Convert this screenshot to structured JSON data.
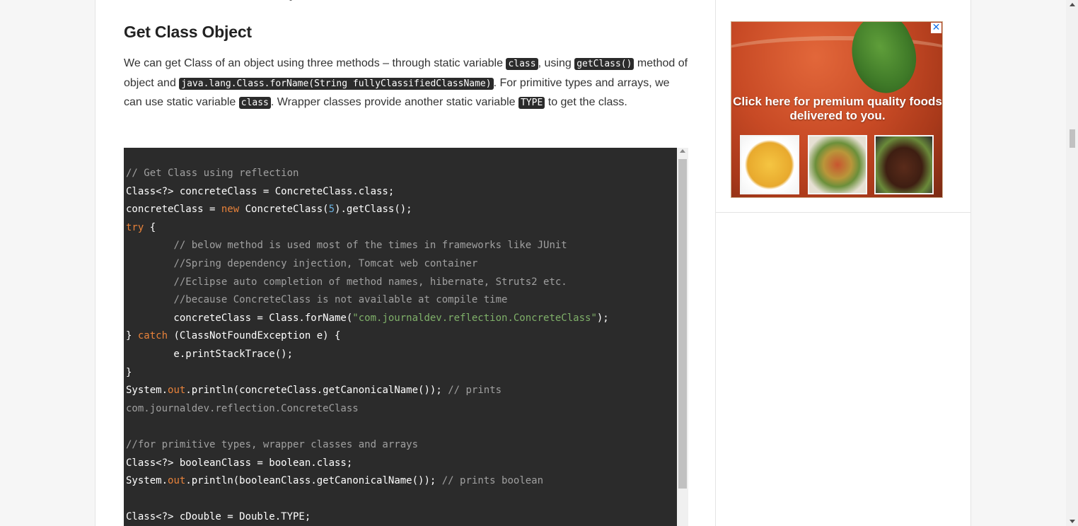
{
  "article": {
    "heading": "Get Class Object",
    "intro": {
      "p1": "We can get Class of an object using three methods – through static variable ",
      "code1": "class",
      "p2": ", using ",
      "code2": "getClass()",
      "p3": " method of object and ",
      "code3": "java.lang.Class.forName(String fullyClassifiedClassName)",
      "p4": ". For primitive types and arrays, we can use static variable ",
      "code4": "class",
      "p5": ". Wrapper classes provide another static variable ",
      "code5": "TYPE",
      "p6": " to get the class."
    },
    "code": [
      [
        {
          "t": "// Get Class using reflection",
          "c": "c-cm"
        }
      ],
      [
        {
          "t": "Class<?> concreteClass = ConcreteClass.class;"
        }
      ],
      [
        {
          "t": "concreteClass = "
        },
        {
          "t": "new",
          "c": "c-kw"
        },
        {
          "t": " ConcreteClass("
        },
        {
          "t": "5",
          "c": "c-num"
        },
        {
          "t": ").getClass();"
        }
      ],
      [
        {
          "t": "try",
          "c": "c-kw"
        },
        {
          "t": " {"
        }
      ],
      [
        {
          "t": "        "
        },
        {
          "t": "// below method is used most of the times in frameworks like JUnit",
          "c": "c-cm"
        }
      ],
      [
        {
          "t": "        "
        },
        {
          "t": "//Spring dependency injection, Tomcat web container",
          "c": "c-cm"
        }
      ],
      [
        {
          "t": "        "
        },
        {
          "t": "//Eclipse auto completion of method names, hibernate, Struts2 etc.",
          "c": "c-cm"
        }
      ],
      [
        {
          "t": "        "
        },
        {
          "t": "//because ConcreteClass is not available at compile time",
          "c": "c-cm"
        }
      ],
      [
        {
          "t": "        concreteClass = Class.forName("
        },
        {
          "t": "\"com.journaldev.reflection.ConcreteClass\"",
          "c": "c-str"
        },
        {
          "t": ");"
        }
      ],
      [
        {
          "t": "} "
        },
        {
          "t": "catch",
          "c": "c-kw"
        },
        {
          "t": " (ClassNotFoundException e) {"
        }
      ],
      [
        {
          "t": "        e.printStackTrace();"
        }
      ],
      [
        {
          "t": "}"
        }
      ],
      [
        {
          "t": "System."
        },
        {
          "t": "out",
          "c": "c-kw"
        },
        {
          "t": ".println(concreteClass.getCanonicalName()); "
        },
        {
          "t": "// prints",
          "c": "c-cm"
        }
      ],
      [
        {
          "t": "com.journaldev.reflection.ConcreteClass",
          "c": "c-cm"
        }
      ],
      [
        {
          "t": ""
        }
      ],
      [
        {
          "t": "//for primitive types, wrapper classes and arrays",
          "c": "c-cm"
        }
      ],
      [
        {
          "t": "Class<?> booleanClass = boolean.class;"
        }
      ],
      [
        {
          "t": "System."
        },
        {
          "t": "out",
          "c": "c-kw"
        },
        {
          "t": ".println(booleanClass.getCanonicalName()); "
        },
        {
          "t": "// prints boolean",
          "c": "c-cm"
        }
      ],
      [
        {
          "t": ""
        }
      ],
      [
        {
          "t": "Class<?> cDouble = Double.TYPE;"
        }
      ]
    ]
  },
  "ad": {
    "text": "Click here for premium quality foods delivered to you.",
    "close_label": "✕"
  },
  "colors": {
    "code_bg": "#2b2b2b",
    "keyword": "#e8823a",
    "comment": "#a0a0a0",
    "string": "#7fb069",
    "number": "#6ab0de"
  }
}
